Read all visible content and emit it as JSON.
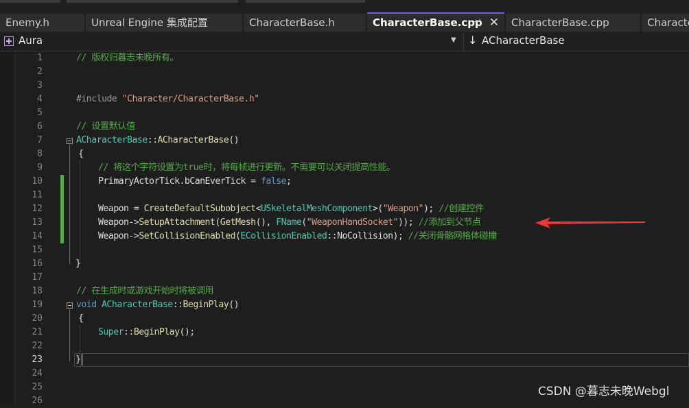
{
  "tabs": [
    {
      "label": "Enemy.h"
    },
    {
      "label": "Unreal Engine 集成配置"
    },
    {
      "label": "CharacterBase.h"
    },
    {
      "label": "CharacterBase.cpp",
      "active": true
    },
    {
      "label": "CharacterBase.cpp"
    },
    {
      "label": "Characte"
    }
  ],
  "nav": {
    "project": "Aura",
    "project_icon": "project-icon",
    "member_icon": "down-arrow-icon",
    "member": "ACharacterBase"
  },
  "editor": {
    "current_line": 23,
    "lines": [
      {
        "n": "1"
      },
      {
        "n": "2"
      },
      {
        "n": "3"
      },
      {
        "n": "4"
      },
      {
        "n": "5"
      },
      {
        "n": "6"
      },
      {
        "n": "7"
      },
      {
        "n": "8"
      },
      {
        "n": "9"
      },
      {
        "n": "10"
      },
      {
        "n": "11"
      },
      {
        "n": "12"
      },
      {
        "n": "13"
      },
      {
        "n": "14"
      },
      {
        "n": "15"
      },
      {
        "n": "16"
      },
      {
        "n": "17"
      },
      {
        "n": "18"
      },
      {
        "n": "19"
      },
      {
        "n": "20"
      },
      {
        "n": "21"
      },
      {
        "n": "22"
      },
      {
        "n": "23"
      },
      {
        "n": "24"
      },
      {
        "n": "25"
      },
      {
        "n": "26"
      }
    ],
    "code": {
      "l1": "// 版权归暮志未晚所有。",
      "l4_a": "#include ",
      "l4_b": "\"Character/CharacterBase.h\"",
      "l6": "// 设置默认值",
      "l7_a": "ACharacterBase",
      "l7_b": "::",
      "l7_c": "ACharacterBase",
      "l7_d": "()",
      "l8": "{",
      "l9": "// 将这个字符设置为true时，将每帧进行更新。不需要可以关闭提高性能。",
      "l10_a": "PrimaryActorTick.bCanEverTick = ",
      "l10_b": "false",
      "l10_c": ";",
      "l12_a": "Weapon = ",
      "l12_b": "CreateDefaultSubobject",
      "l12_c": "<",
      "l12_d": "USkeletalMeshComponent",
      "l12_e": ">(",
      "l12_f": "\"Weapon\"",
      "l12_g": "); ",
      "l12_h": "//创建控件",
      "l13_a": "Weapon->",
      "l13_b": "SetupAttachment",
      "l13_c": "(",
      "l13_d": "GetMesh",
      "l13_e": "(), ",
      "l13_f": "FName",
      "l13_g": "(",
      "l13_h": "\"WeaponHandSocket\"",
      "l13_i": ")); ",
      "l13_j": "//添加到父节点",
      "l14_a": "Weapon->",
      "l14_b": "SetCollisionEnabled",
      "l14_c": "(",
      "l14_d": "ECollisionEnabled",
      "l14_e": "::NoCollision); ",
      "l14_f": "//关闭骨骼网格体碰撞",
      "l16": "}",
      "l18": "// 在生成时或游戏开始时将被调用",
      "l19_a": "void ",
      "l19_b": "ACharacterBase",
      "l19_c": "::",
      "l19_d": "BeginPlay",
      "l19_e": "()",
      "l20": "{",
      "l21_a": "Super",
      "l21_b": "::",
      "l21_c": "BeginPlay",
      "l21_d": "();",
      "l23": "}"
    }
  },
  "icons": {
    "pin": "pin-icon",
    "close": "close-icon",
    "dropdown": "chevron-down-icon"
  },
  "colors": {
    "accent": "#7160e8",
    "comment": "#57a64a",
    "keyword": "#569cd6",
    "type": "#4ec9b0",
    "function": "#dcdcaa",
    "string": "#d69d85",
    "annotation_arrow": "#e8383c"
  },
  "watermark": "CSDN @暮志未晚Webgl"
}
